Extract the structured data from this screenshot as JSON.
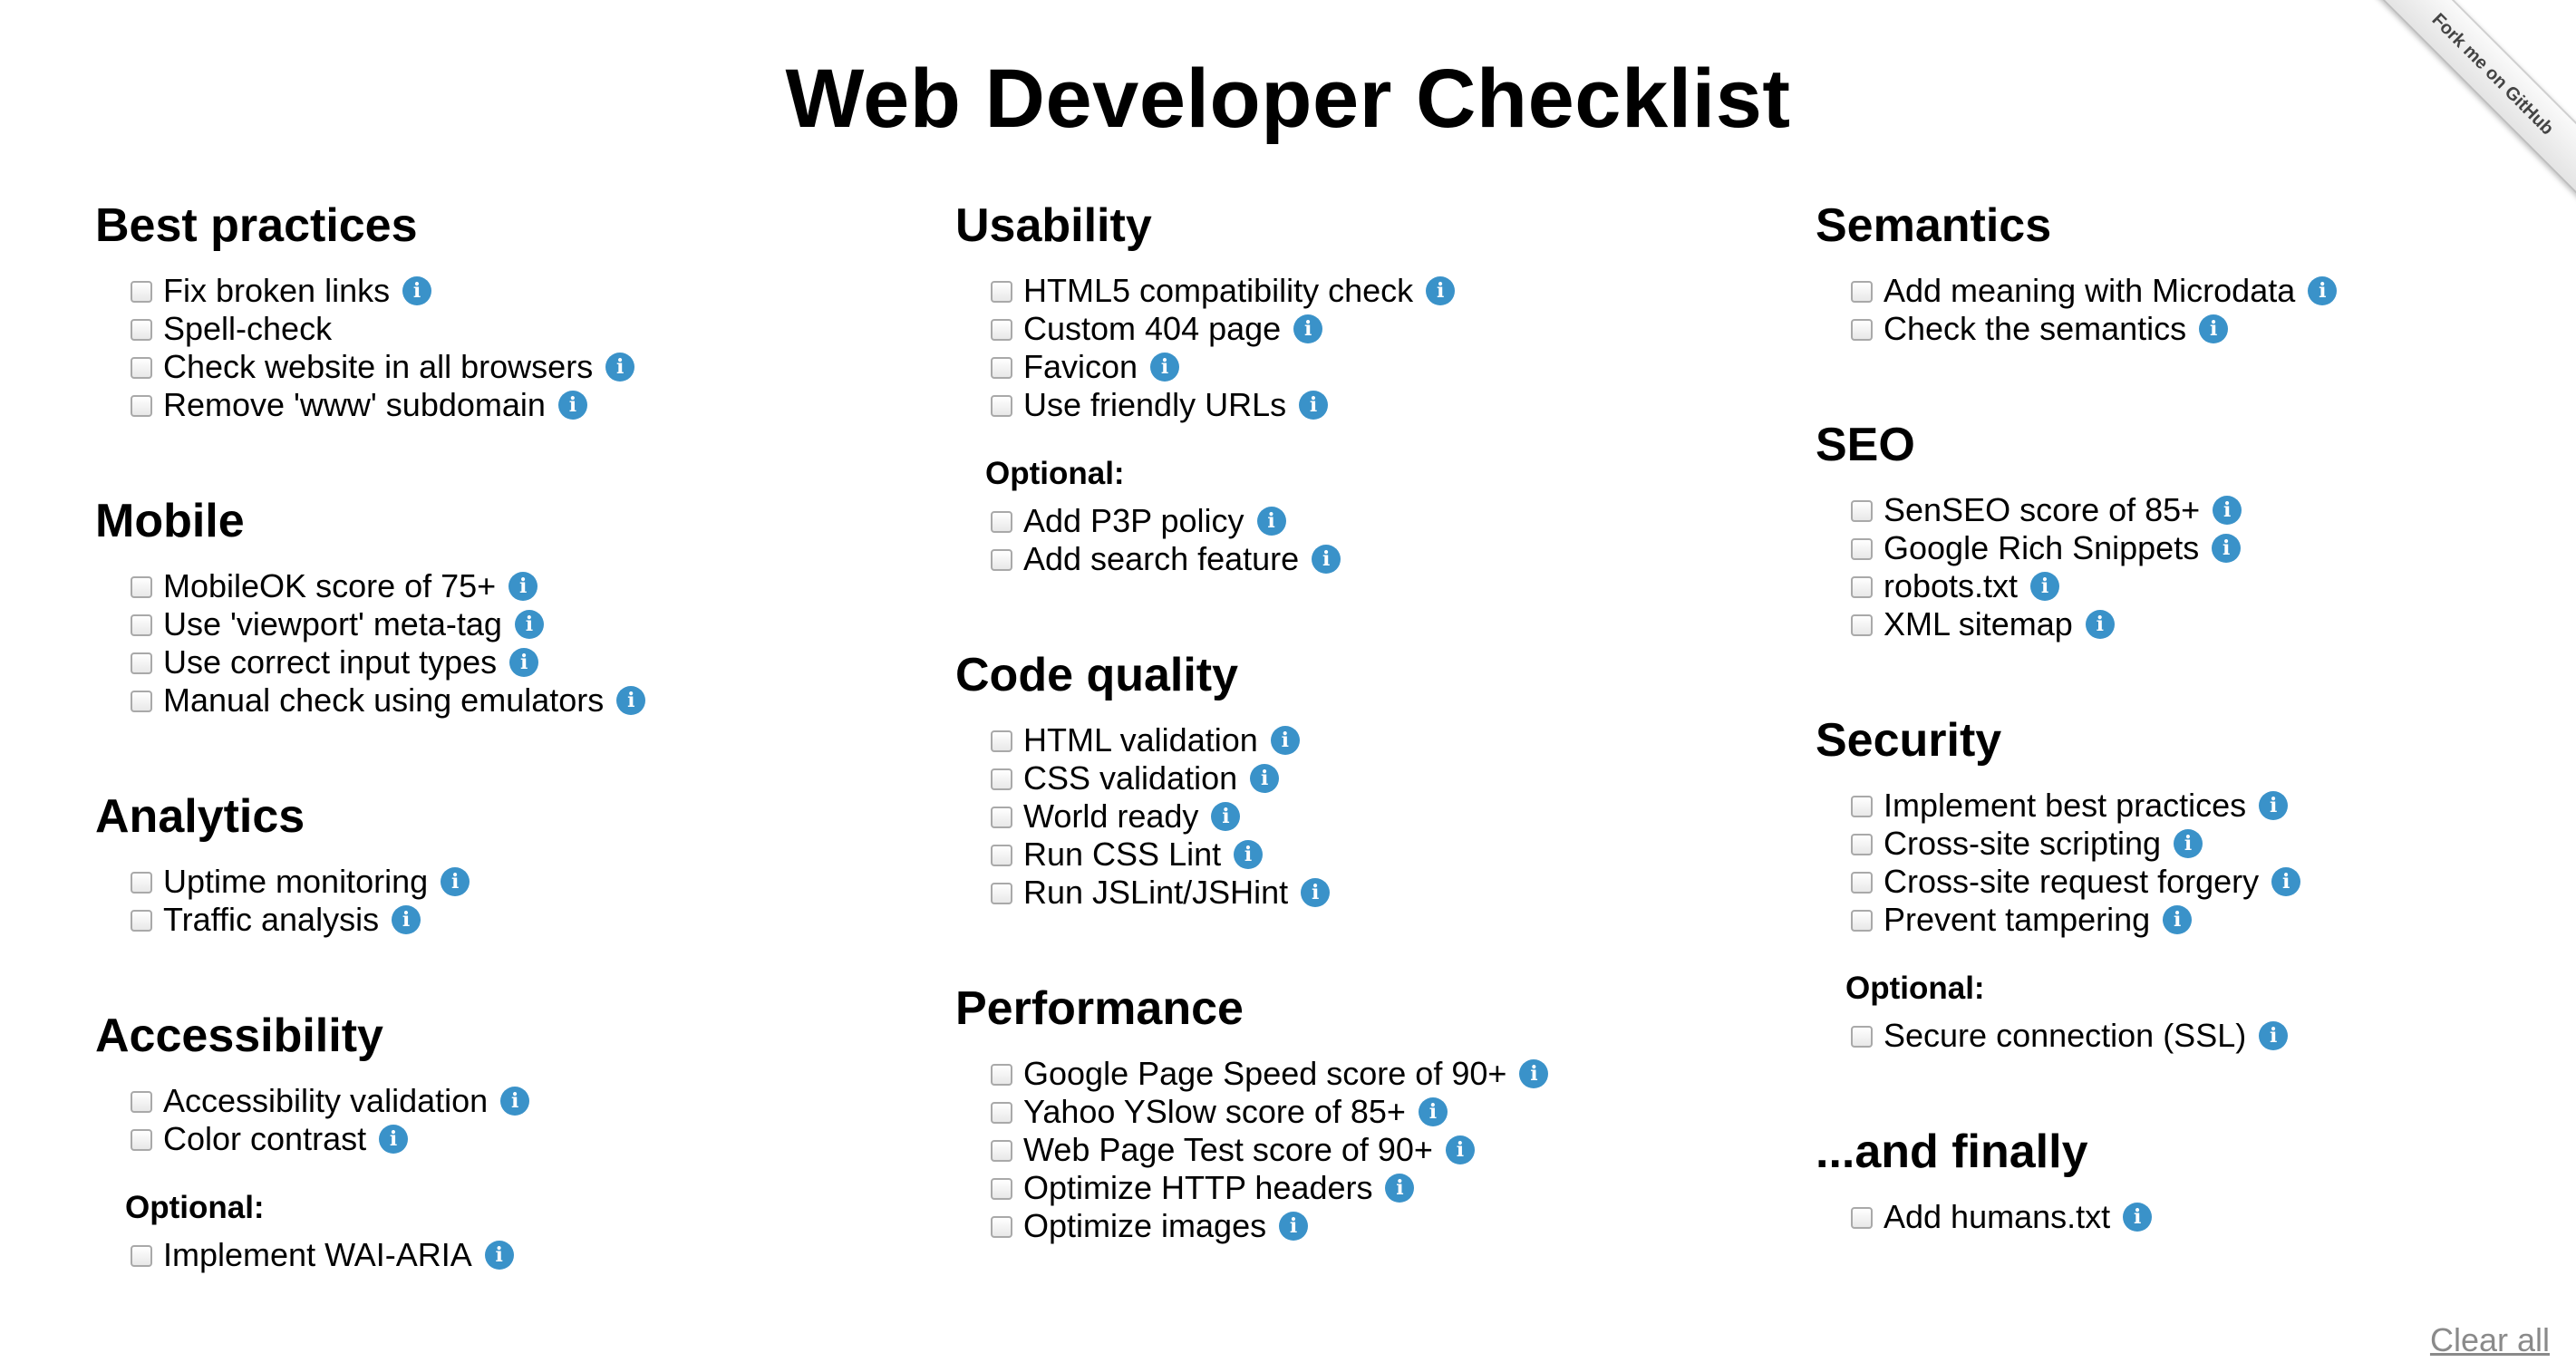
{
  "title": "Web Developer Checklist",
  "ribbon": "Fork me on GitHub",
  "clear_all": "Clear all",
  "info_glyph": "i",
  "colors": {
    "info_icon": "#3a92c9",
    "clear_link": "#8a8a8a"
  },
  "columns": [
    {
      "sections": [
        {
          "heading": "Best practices",
          "items": [
            "Fix broken links",
            "Spell-check",
            "Check website in all browsers",
            "Remove 'www' subdomain"
          ],
          "info": [
            true,
            false,
            true,
            true
          ]
        },
        {
          "heading": "Mobile",
          "items": [
            "MobileOK score of 75+",
            "Use 'viewport' meta-tag",
            "Use correct input types",
            "Manual check using emulators"
          ],
          "info": [
            true,
            true,
            true,
            true
          ]
        },
        {
          "heading": "Analytics",
          "items": [
            "Uptime monitoring",
            "Traffic analysis"
          ],
          "info": [
            true,
            true
          ]
        },
        {
          "heading": "Accessibility",
          "items": [
            "Accessibility validation",
            "Color contrast"
          ],
          "info": [
            true,
            true
          ],
          "optional_label": "Optional:",
          "optional_items": [
            "Implement WAI-ARIA"
          ],
          "optional_info": [
            true
          ]
        }
      ]
    },
    {
      "sections": [
        {
          "heading": "Usability",
          "items": [
            "HTML5 compatibility check",
            "Custom 404 page",
            "Favicon",
            "Use friendly URLs"
          ],
          "info": [
            true,
            true,
            true,
            true
          ],
          "optional_label": "Optional:",
          "optional_items": [
            "Add P3P policy",
            "Add search feature"
          ],
          "optional_info": [
            true,
            true
          ]
        },
        {
          "heading": "Code quality",
          "items": [
            "HTML validation",
            "CSS validation",
            "World ready",
            "Run CSS Lint",
            "Run JSLint/JSHint"
          ],
          "info": [
            true,
            true,
            true,
            true,
            true
          ]
        },
        {
          "heading": "Performance",
          "items": [
            "Google Page Speed score of 90+",
            "Yahoo YSlow score of 85+",
            "Web Page Test score of 90+",
            "Optimize HTTP headers",
            "Optimize images"
          ],
          "info": [
            true,
            true,
            true,
            true,
            true
          ]
        }
      ]
    },
    {
      "sections": [
        {
          "heading": "Semantics",
          "items": [
            "Add meaning with Microdata",
            "Check the semantics"
          ],
          "info": [
            true,
            true
          ]
        },
        {
          "heading": "SEO",
          "items": [
            "SenSEO score of 85+",
            "Google Rich Snippets",
            "robots.txt",
            "XML sitemap"
          ],
          "info": [
            true,
            true,
            true,
            true
          ]
        },
        {
          "heading": "Security",
          "items": [
            "Implement best practices",
            "Cross-site scripting",
            "Cross-site request forgery",
            "Prevent tampering"
          ],
          "info": [
            true,
            true,
            true,
            true
          ],
          "optional_label": "Optional:",
          "optional_items": [
            "Secure connection (SSL)"
          ],
          "optional_info": [
            true
          ]
        },
        {
          "heading": "...and finally",
          "items": [
            "Add humans.txt"
          ],
          "info": [
            true
          ]
        }
      ]
    }
  ]
}
